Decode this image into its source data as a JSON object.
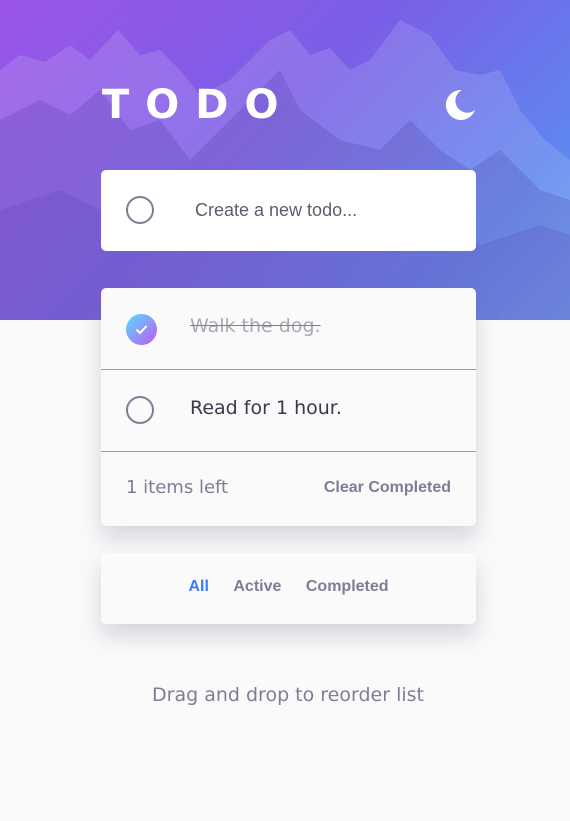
{
  "app": {
    "title": "TODO",
    "theme_icon": "moon-icon"
  },
  "new_todo": {
    "placeholder": "Create a new todo...",
    "value": ""
  },
  "todos": [
    {
      "text": "Walk the dog.",
      "completed": true
    },
    {
      "text": "Read for 1 hour.",
      "completed": false
    }
  ],
  "footer": {
    "items_left": "1 items left",
    "clear_label": "Clear Completed"
  },
  "filters": {
    "all": "All",
    "active": "Active",
    "completed": "Completed",
    "selected": "All"
  },
  "hint": "Drag and drop to reorder list",
  "colors": {
    "accent": "#3a7bfd",
    "check_gradient_start": "#57ddff",
    "check_gradient_end": "#c058f3",
    "text_dark": "#393a4c",
    "text_muted": "#7d7e95",
    "page_bg": "#fafafa"
  }
}
